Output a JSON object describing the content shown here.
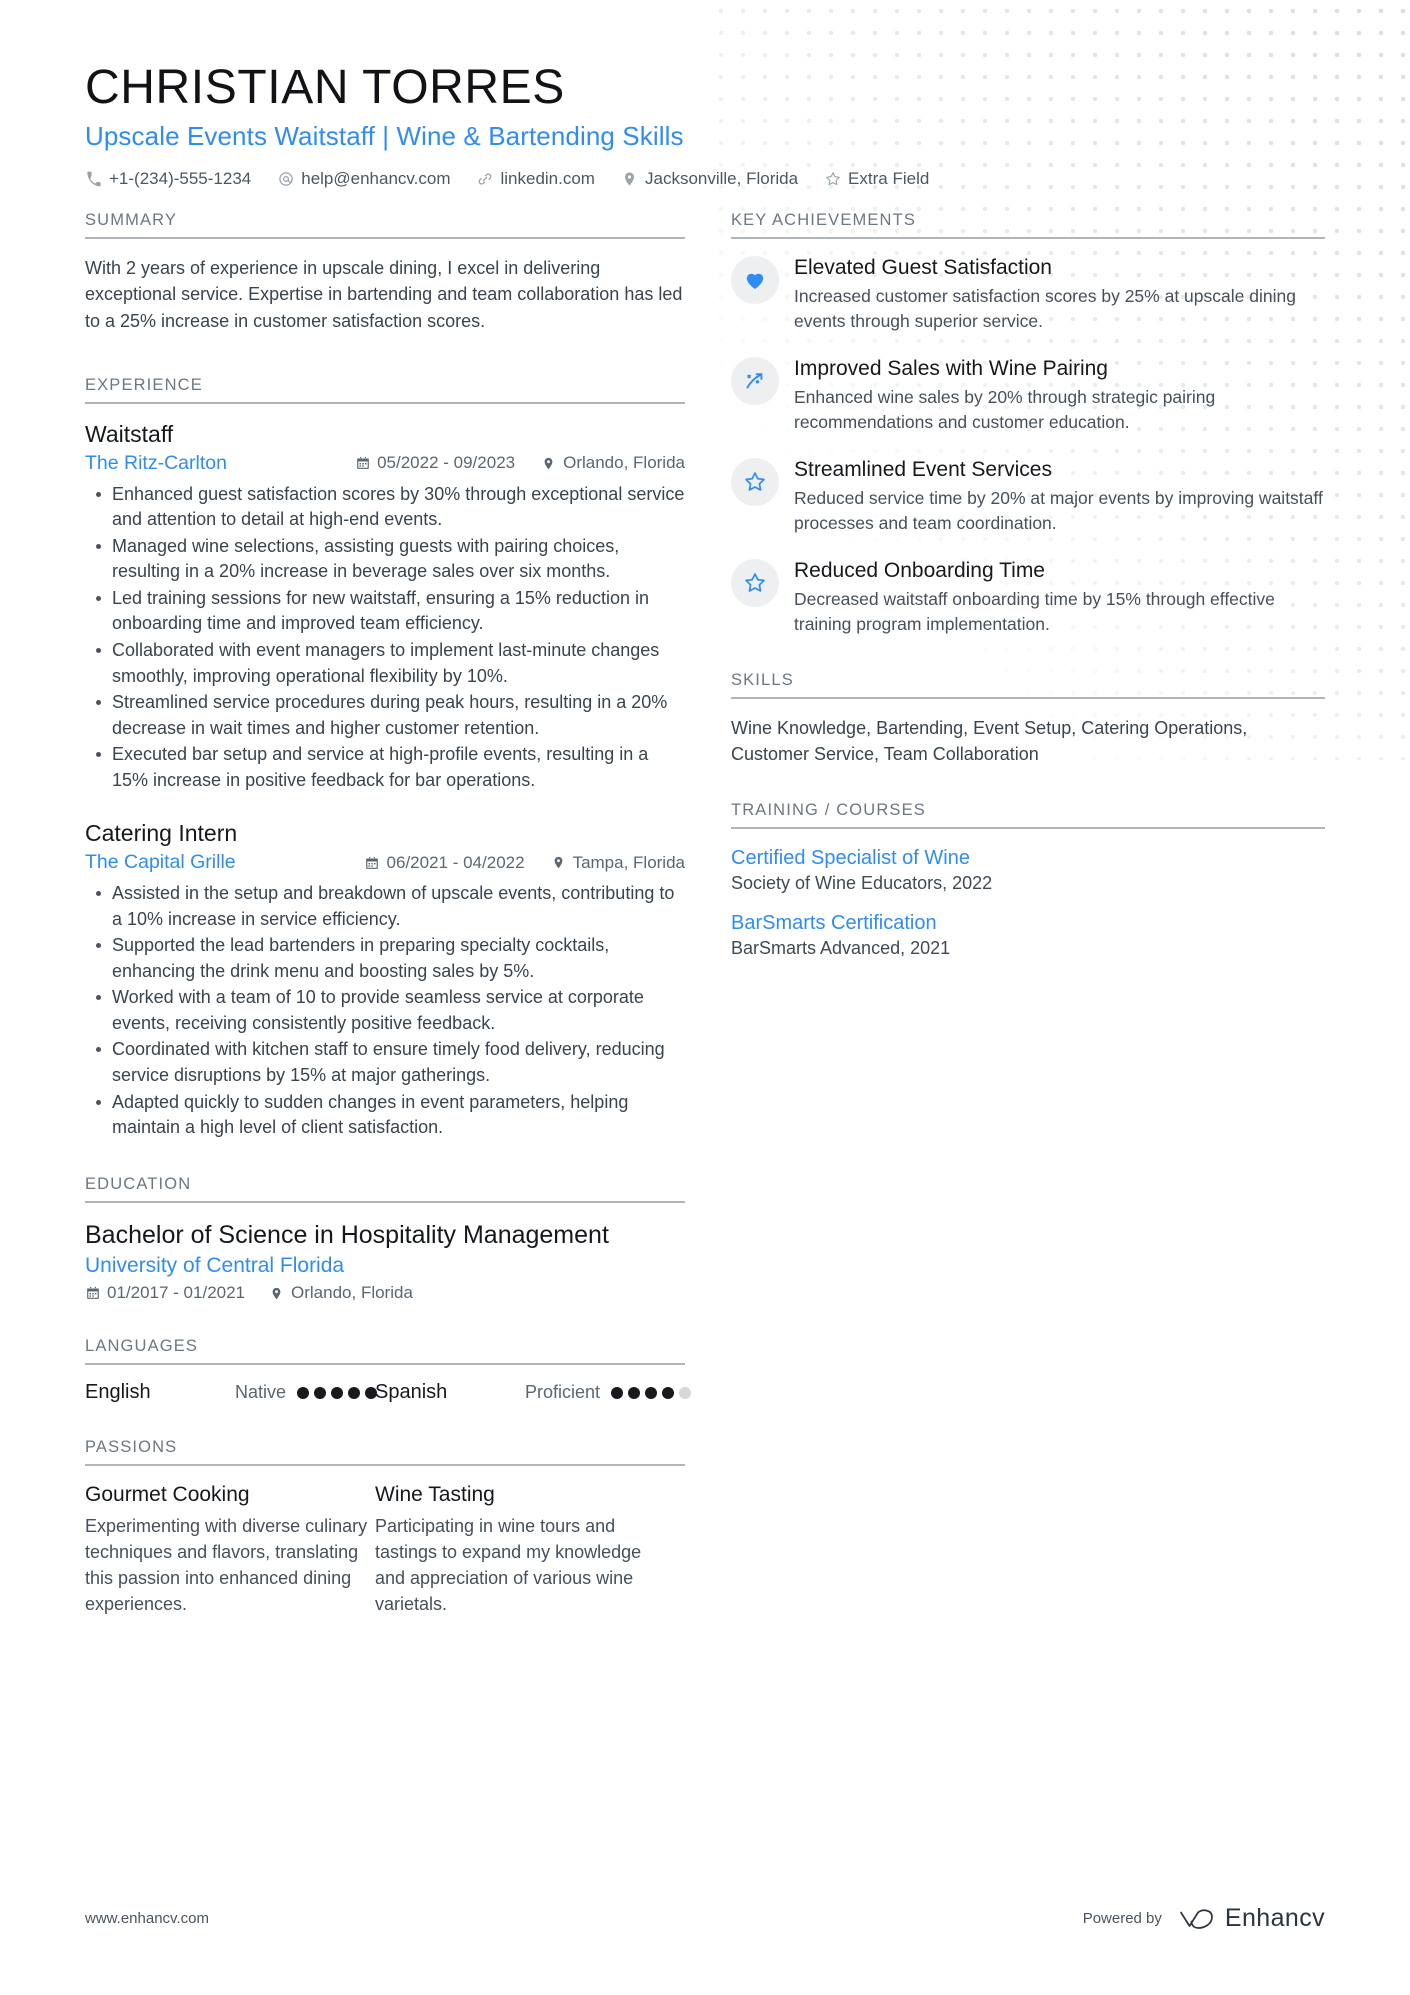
{
  "header": {
    "name": "CHRISTIAN TORRES",
    "headline": "Upscale Events Waitstaff | Wine & Bartending Skills",
    "contacts": [
      {
        "icon": "phone-icon",
        "text": "+1-(234)-555-1234"
      },
      {
        "icon": "email-icon",
        "text": "help@enhancv.com"
      },
      {
        "icon": "link-icon",
        "text": "linkedin.com"
      },
      {
        "icon": "location-icon",
        "text": "Jacksonville, Florida"
      },
      {
        "icon": "star-icon",
        "text": "Extra Field"
      }
    ]
  },
  "sections": {
    "summary_title": "SUMMARY",
    "experience_title": "EXPERIENCE",
    "education_title": "EDUCATION",
    "languages_title": "LANGUAGES",
    "passions_title": "PASSIONS",
    "achievements_title": "KEY ACHIEVEMENTS",
    "skills_title": "SKILLS",
    "training_title": "TRAINING / COURSES"
  },
  "summary": {
    "text": "With 2 years of experience in upscale dining, I excel in delivering exceptional service. Expertise in bartending and team collaboration has led to a 25% increase in customer satisfaction scores."
  },
  "experience": [
    {
      "title": "Waitstaff",
      "organization": "The Ritz-Carlton",
      "dates": "05/2022 - 09/2023",
      "location": "Orlando, Florida",
      "bullets": [
        "Enhanced guest satisfaction scores by 30% through exceptional service and attention to detail at high-end events.",
        "Managed wine selections, assisting guests with pairing choices, resulting in a 20% increase in beverage sales over six months.",
        "Led training sessions for new waitstaff, ensuring a 15% reduction in onboarding time and improved team efficiency.",
        "Collaborated with event managers to implement last-minute changes smoothly, improving operational flexibility by 10%.",
        "Streamlined service procedures during peak hours, resulting in a 20% decrease in wait times and higher customer retention.",
        "Executed bar setup and service at high-profile events, resulting in a 15% increase in positive feedback for bar operations."
      ]
    },
    {
      "title": "Catering Intern",
      "organization": "The Capital Grille",
      "dates": "06/2021 - 04/2022",
      "location": "Tampa, Florida",
      "bullets": [
        "Assisted in the setup and breakdown of upscale events, contributing to a 10% increase in service efficiency.",
        "Supported the lead bartenders in preparing specialty cocktails, enhancing the drink menu and boosting sales by 5%.",
        "Worked with a team of 10 to provide seamless service at corporate events, receiving consistently positive feedback.",
        "Coordinated with kitchen staff to ensure timely food delivery, reducing service disruptions by 15% at major gatherings.",
        "Adapted quickly to sudden changes in event parameters, helping maintain a high level of client satisfaction."
      ]
    }
  ],
  "education": [
    {
      "degree": "Bachelor of Science in Hospitality Management",
      "school": "University of Central Florida",
      "dates": "01/2017 - 01/2021",
      "location": "Orlando, Florida"
    }
  ],
  "languages": [
    {
      "name": "English",
      "level": "Native",
      "filled": 5,
      "total": 5
    },
    {
      "name": "Spanish",
      "level": "Proficient",
      "filled": 4,
      "total": 5
    }
  ],
  "passions": [
    {
      "title": "Gourmet Cooking",
      "description": "Experimenting with diverse culinary techniques and flavors, translating this passion into enhanced dining experiences."
    },
    {
      "title": "Wine Tasting",
      "description": "Participating in wine tours and tastings to expand my knowledge and appreciation of various wine varietals."
    }
  ],
  "achievements": [
    {
      "icon": "heart-icon",
      "title": "Elevated Guest Satisfaction",
      "description": "Increased customer satisfaction scores by 25% at upscale dining events through superior service."
    },
    {
      "icon": "trending-up-icon",
      "title": "Improved Sales with Wine Pairing",
      "description": "Enhanced wine sales by 20% through strategic pairing recommendations and customer education."
    },
    {
      "icon": "star-outline-icon",
      "title": "Streamlined Event Services",
      "description": "Reduced service time by 20% at major events by improving waitstaff processes and team coordination."
    },
    {
      "icon": "star-outline-icon",
      "title": "Reduced Onboarding Time",
      "description": "Decreased waitstaff onboarding time by 15% through effective training program implementation."
    }
  ],
  "skills": {
    "text": "Wine Knowledge, Bartending, Event Setup, Catering Operations, Customer Service, Team Collaboration"
  },
  "training": [
    {
      "name": "Certified Specialist of Wine",
      "detail": "Society of Wine Educators, 2022"
    },
    {
      "name": "BarSmarts Certification",
      "detail": "BarSmarts Advanced, 2021"
    }
  ],
  "footer": {
    "url": "www.enhancv.com",
    "powered_by": "Powered by",
    "brand": "Enhancv"
  },
  "colors": {
    "accent": "#2f8cf5",
    "heading": "#6b7782",
    "text": "#38444f",
    "rule": "#b0b5ba",
    "icon_bubble": "#eeeff0"
  }
}
